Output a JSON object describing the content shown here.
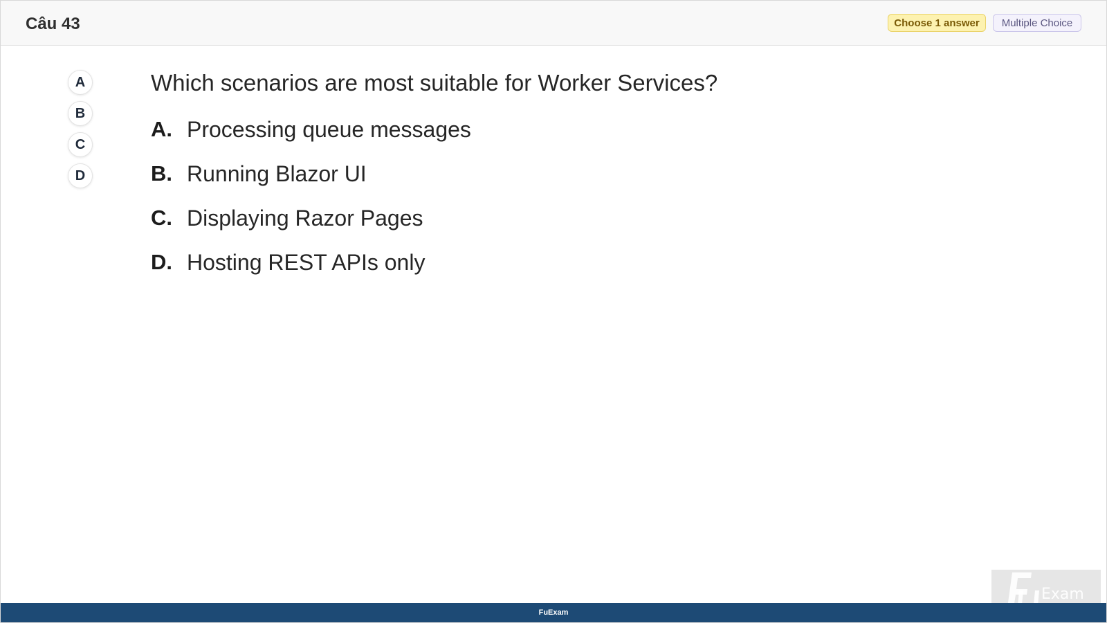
{
  "header": {
    "question_number": "Câu 43",
    "choose_badge": "Choose 1 answer",
    "type_badge": "Multiple Choice"
  },
  "answer_buttons": [
    "A",
    "B",
    "C",
    "D"
  ],
  "question": {
    "text": "Which scenarios are most suitable for Worker Services?",
    "options": [
      {
        "letter": "A.",
        "text": "Processing queue messages"
      },
      {
        "letter": "B.",
        "text": "Running Blazor UI"
      },
      {
        "letter": "C.",
        "text": "Displaying Razor Pages"
      },
      {
        "letter": "D.",
        "text": "Hosting REST APIs only"
      }
    ]
  },
  "footer": {
    "brand": "FuExam"
  },
  "watermark": {
    "text": "FU Exam"
  },
  "colors": {
    "footer_bg": "#1d4a75",
    "choose_badge_bg": "#fdf2b0",
    "type_badge_bg": "#f4f2fc"
  }
}
